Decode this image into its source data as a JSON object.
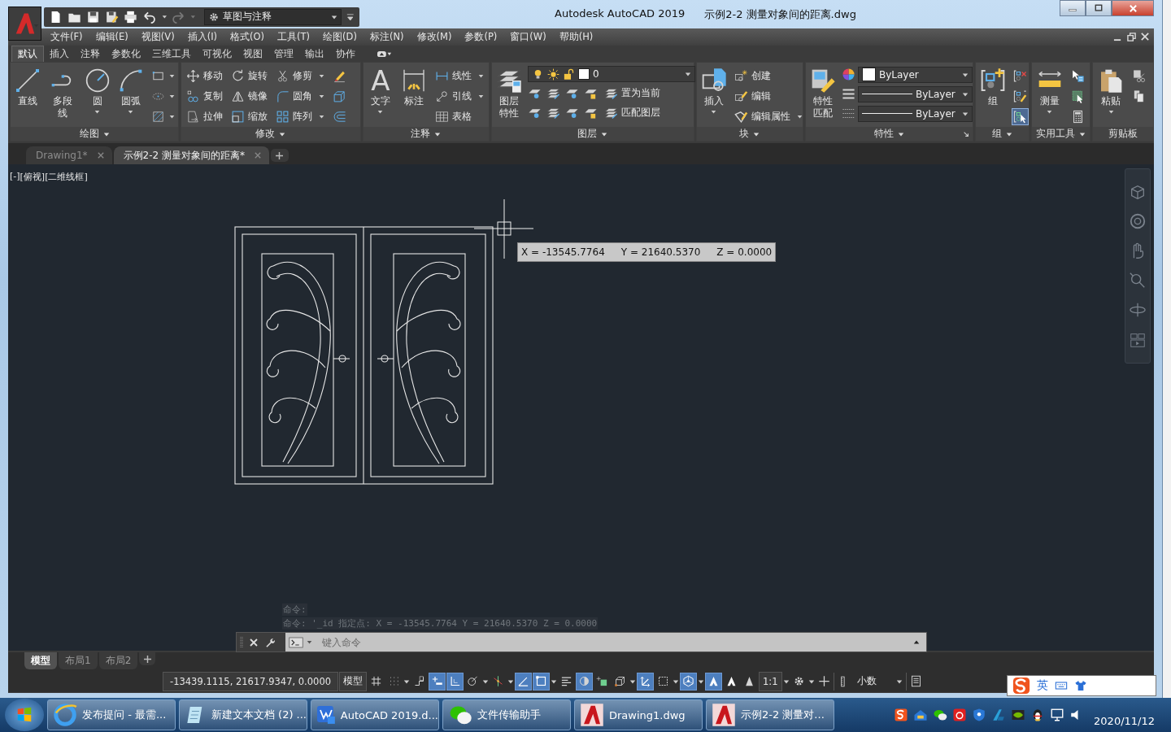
{
  "title_bar": {
    "workspace": "草图与注释",
    "app_title": "Autodesk AutoCAD 2019",
    "document": "示例2-2  测量对象间的距离.dwg"
  },
  "menu": [
    "文件(F)",
    "编辑(E)",
    "视图(V)",
    "插入(I)",
    "格式(O)",
    "工具(T)",
    "绘图(D)",
    "标注(N)",
    "修改(M)",
    "参数(P)",
    "窗口(W)",
    "帮助(H)"
  ],
  "ribbon_tabs": [
    {
      "label": "默认",
      "selected": true
    },
    {
      "label": "插入",
      "selected": false
    },
    {
      "label": "注释",
      "selected": false
    },
    {
      "label": "参数化",
      "selected": false
    },
    {
      "label": "三维工具",
      "selected": false
    },
    {
      "label": "可视化",
      "selected": false
    },
    {
      "label": "视图",
      "selected": false
    },
    {
      "label": "管理",
      "selected": false
    },
    {
      "label": "输出",
      "selected": false
    },
    {
      "label": "协作",
      "selected": false
    }
  ],
  "panels": [
    {
      "title": "绘图",
      "menu": true,
      "columns": [
        {
          "kind": "large",
          "label": "直线",
          "dropdown": false
        },
        {
          "kind": "large",
          "label": "多段线",
          "dropdown": false
        },
        {
          "kind": "large",
          "label": "圆",
          "dropdown": true
        },
        {
          "kind": "large",
          "label": "圆弧",
          "dropdown": true
        },
        {
          "kind": "icons",
          "items": [
            {
              "dropdown": true,
              "on": false
            },
            {
              "dropdown": true,
              "on": false
            },
            {
              "dropdown": true,
              "on": false
            }
          ]
        }
      ]
    },
    {
      "title": "修改",
      "menu": true,
      "columns": [
        {
          "kind": "stack",
          "items": [
            {
              "label": "移动",
              "dropdown": false
            },
            {
              "label": "复制",
              "dropdown": false
            },
            {
              "label": "拉伸",
              "dropdown": false
            }
          ]
        },
        {
          "kind": "stack",
          "items": [
            {
              "label": "旋转",
              "dropdown": false
            },
            {
              "label": "镜像",
              "dropdown": false
            },
            {
              "label": "缩放",
              "dropdown": false
            }
          ]
        },
        {
          "kind": "stack",
          "items": [
            {
              "label": "修剪",
              "dropdown": true
            },
            {
              "label": "圆角",
              "dropdown": true
            },
            {
              "label": "阵列",
              "dropdown": true
            }
          ]
        },
        {
          "kind": "icons",
          "items": [
            {
              "dropdown": false,
              "on": false
            },
            {
              "dropdown": false,
              "on": false
            },
            {
              "dropdown": false,
              "on": false
            }
          ]
        }
      ]
    },
    {
      "title": "注释",
      "menu": true,
      "columns": [
        {
          "kind": "large",
          "glyph": "A",
          "label": "文字",
          "dropdown": true
        },
        {
          "kind": "large",
          "label": "标注",
          "dropdown": false
        },
        {
          "kind": "stack",
          "items": [
            {
              "label": "线性",
              "dropdown": true
            },
            {
              "label": "引线",
              "dropdown": true
            },
            {
              "label": "表格",
              "dropdown": false
            }
          ]
        }
      ]
    },
    {
      "title": "图层",
      "menu": true,
      "columns": [
        {
          "kind": "large",
          "label": "图层特性",
          "dropdown": false
        },
        {
          "kind": "layers",
          "layer": "0",
          "rows": [
            {
              "label": "置为当前"
            },
            {
              "label": "匹配图层"
            }
          ]
        }
      ]
    },
    {
      "title": "块",
      "menu": true,
      "columns": [
        {
          "kind": "large",
          "label": "插入",
          "dropdown": true
        },
        {
          "kind": "stack",
          "items": [
            {
              "label": "创建",
              "dropdown": false
            },
            {
              "label": "编辑",
              "dropdown": false
            },
            {
              "label": "编辑属性",
              "dropdown": true
            }
          ]
        }
      ]
    },
    {
      "title": "特性",
      "menu": true,
      "launcher": true,
      "columns": [
        {
          "kind": "large",
          "label": "特性匹配",
          "dropdown": false
        },
        {
          "kind": "props",
          "combos": [
            {
              "kind": "color",
              "value": "ByLayer"
            },
            {
              "kind": "lineweight",
              "value": "ByLayer"
            },
            {
              "kind": "linetype",
              "value": "ByLayer"
            }
          ]
        }
      ]
    },
    {
      "title": "组",
      "menu": true,
      "columns": [
        {
          "kind": "large",
          "label": "组",
          "dropdown": false
        },
        {
          "kind": "icons",
          "items": [
            {
              "dropdown": false,
              "on": false
            },
            {
              "dropdown": false,
              "on": false
            },
            {
              "dropdown": false,
              "on": true
            }
          ]
        }
      ]
    },
    {
      "title": "实用工具",
      "menu": true,
      "columns": [
        {
          "kind": "large",
          "label": "测量",
          "dropdown": true
        },
        {
          "kind": "icons",
          "items": [
            {
              "dropdown": false,
              "on": false
            },
            {
              "dropdown": false,
              "on": false
            },
            {
              "dropdown": false,
              "on": false
            }
          ]
        }
      ]
    },
    {
      "title": "剪贴板",
      "menu": false,
      "columns": [
        {
          "kind": "large",
          "label": "粘贴",
          "dropdown": true
        },
        {
          "kind": "icons",
          "items": [
            {
              "dropdown": false,
              "on": false
            },
            {
              "dropdown": false,
              "on": false
            }
          ]
        }
      ]
    }
  ],
  "file_tabs": [
    {
      "label": "Drawing1*",
      "selected": false
    },
    {
      "label": "示例2-2  测量对象间的距离*",
      "selected": true
    }
  ],
  "viewport_controls": [
    "[-]",
    "[俯视]",
    "[二维线框]"
  ],
  "tooltip": [
    "X = -13545.7764",
    "Y = 21640.5370",
    "Z = 0.0000"
  ],
  "command": {
    "history": [
      "命令:",
      "命令: '_id 指定点:  X = -13545.7764     Y = 21640.5370     Z = 0.0000"
    ],
    "placeholder": "键入命令"
  },
  "layout_tabs": [
    {
      "label": "模型",
      "selected": true
    },
    {
      "label": "布局1",
      "selected": false
    },
    {
      "label": "布局2",
      "selected": false
    }
  ],
  "status_bar": {
    "coordinates": "-13439.1115, 21617.9347, 0.0000",
    "items": [
      {
        "kind": "text",
        "label": "模型",
        "dropdown": false
      },
      {
        "kind": "icon",
        "on": false,
        "dropdown": false
      },
      {
        "kind": "icon",
        "on": false,
        "dropdown": true
      },
      {
        "kind": "icon",
        "on": false,
        "dropdown": false
      },
      {
        "kind": "icon",
        "on": true,
        "dropdown": false
      },
      {
        "kind": "icon",
        "on": true,
        "dropdown": false
      },
      {
        "kind": "icon",
        "on": false,
        "dropdown": true
      },
      {
        "kind": "icon",
        "on": false,
        "dropdown": true
      },
      {
        "kind": "icon",
        "on": true,
        "dropdown": false
      },
      {
        "kind": "icon",
        "on": true,
        "dropdown": true
      },
      {
        "kind": "icon",
        "on": false,
        "dropdown": false
      },
      {
        "kind": "icon",
        "on": true,
        "dropdown": false
      },
      {
        "kind": "icon",
        "on": false,
        "dropdown": false
      },
      {
        "kind": "icon",
        "on": false,
        "dropdown": true
      },
      {
        "kind": "icon",
        "on": true,
        "dropdown": false
      },
      {
        "kind": "icon",
        "on": false,
        "dropdown": true
      },
      {
        "kind": "icon",
        "on": true,
        "dropdown": true
      },
      {
        "kind": "icon",
        "on": true,
        "dropdown": false
      },
      {
        "kind": "icon",
        "on": false,
        "dropdown": false
      },
      {
        "kind": "icon",
        "on": false,
        "dropdown": false
      },
      {
        "kind": "text",
        "label": "1:1",
        "dropdown": true
      },
      {
        "kind": "icon",
        "on": false,
        "dropdown": true
      },
      {
        "kind": "icon",
        "on": false,
        "dropdown": false
      },
      {
        "kind": "combo",
        "label": "小数",
        "dropdown": true
      },
      {
        "kind": "icon",
        "on": false,
        "dropdown": false
      }
    ]
  },
  "ime_bar": {
    "mode": "英"
  },
  "taskbar": {
    "buttons": [
      {
        "label": "发布提问 - 最需..."
      },
      {
        "label": "新建文本文档 (2) ..."
      },
      {
        "label": "AutoCAD 2019.d..."
      },
      {
        "label": "文件传输助手"
      },
      {
        "label": "Drawing1.dwg"
      },
      {
        "label": "示例2-2  测量对..."
      }
    ],
    "date": "2020/11/12"
  }
}
